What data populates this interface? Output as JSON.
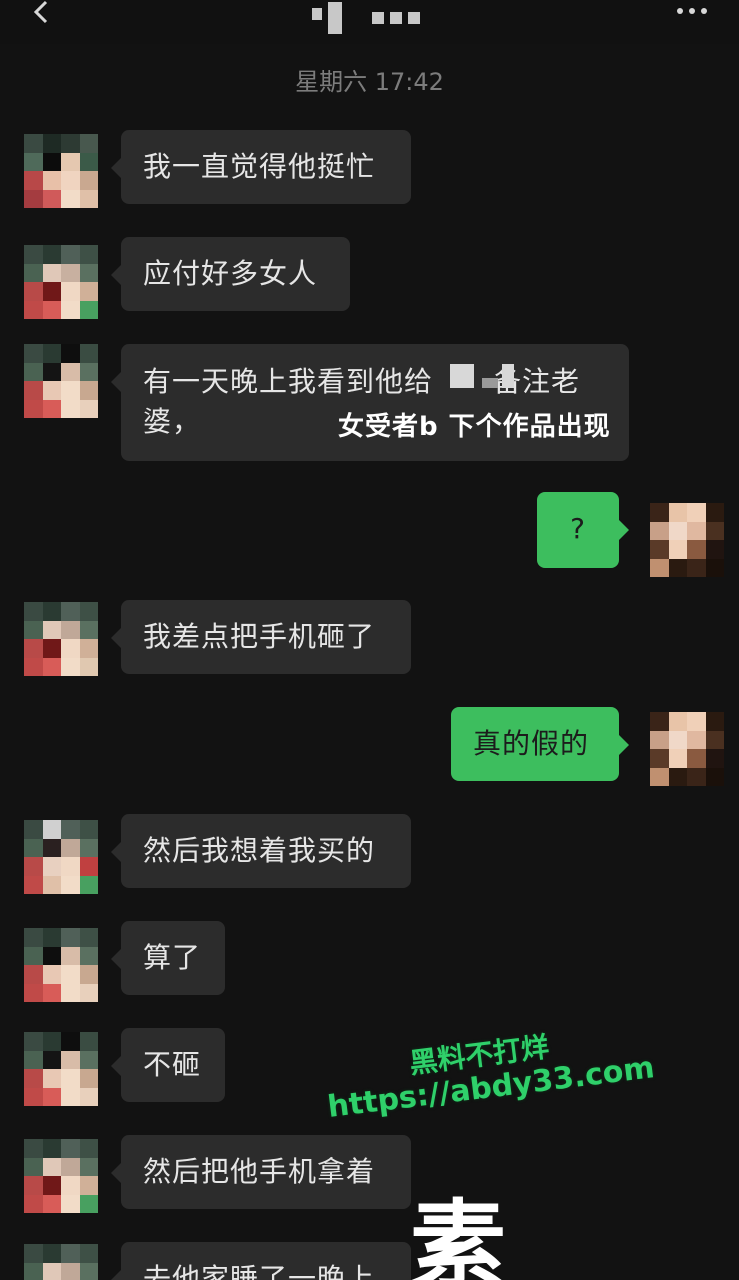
{
  "header": {
    "back_icon": "chevron-left-icon",
    "more_icon": "more-dots-icon"
  },
  "timestamp": "星期六 17:42",
  "messages": [
    {
      "side": "left",
      "text": "我一直觉得他挺忙"
    },
    {
      "side": "left",
      "text": "应付好多女人"
    },
    {
      "side": "left",
      "line1_a": "有一天晚上我看到他给",
      "line1_b": "备注老",
      "line2": "婆，"
    },
    {
      "side": "right",
      "text": "?"
    },
    {
      "side": "left",
      "text": "我差点把手机砸了"
    },
    {
      "side": "right",
      "text": "真的假的"
    },
    {
      "side": "left",
      "text": "然后我想着我买的"
    },
    {
      "side": "left",
      "text": "算了"
    },
    {
      "side": "left",
      "text": "不砸"
    },
    {
      "side": "left",
      "text": "然后把他手机拿着"
    },
    {
      "side": "left",
      "text": "去他家睡了一晚上"
    }
  ],
  "overlay_caption": "女受者b 下个作品出现",
  "watermark": {
    "line1": "黑料不打烊",
    "line2": "https://abdy33.com"
  },
  "big_char": "素",
  "colors": {
    "background": "#121212",
    "bubble_left": "#2c2c2c",
    "bubble_right": "#3dbe5e",
    "watermark": "#2fd06a"
  }
}
